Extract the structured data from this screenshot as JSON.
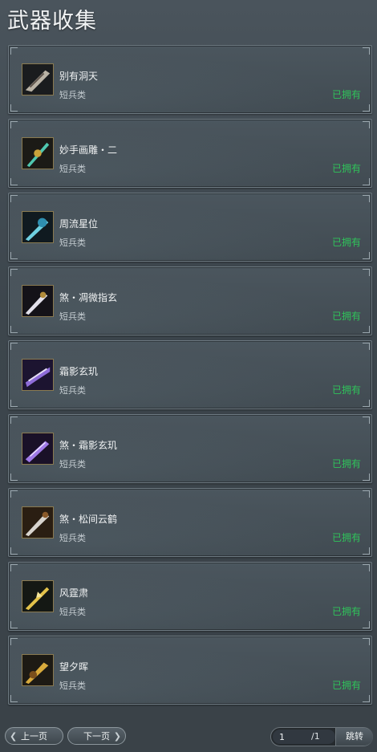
{
  "title": "武器收集",
  "items": [
    {
      "name": "别有洞天",
      "category": "短兵类",
      "status": "已拥有",
      "icon": "weapon-icon-1"
    },
    {
      "name": "妙手画雕・二",
      "category": "短兵类",
      "status": "已拥有",
      "icon": "weapon-icon-2"
    },
    {
      "name": "周流星位",
      "category": "短兵类",
      "status": "已拥有",
      "icon": "weapon-icon-3"
    },
    {
      "name": "煞・凋微指玄",
      "category": "短兵类",
      "status": "已拥有",
      "icon": "weapon-icon-4"
    },
    {
      "name": "霜影玄玑",
      "category": "短兵类",
      "status": "已拥有",
      "icon": "weapon-icon-5"
    },
    {
      "name": "煞・霜影玄玑",
      "category": "短兵类",
      "status": "已拥有",
      "icon": "weapon-icon-6"
    },
    {
      "name": "煞・松间云鹤",
      "category": "短兵类",
      "status": "已拥有",
      "icon": "weapon-icon-7"
    },
    {
      "name": "风霆肃",
      "category": "短兵类",
      "status": "已拥有",
      "icon": "weapon-icon-8"
    },
    {
      "name": "望夕晖",
      "category": "短兵类",
      "status": "已拥有",
      "icon": "weapon-icon-9"
    }
  ],
  "pager": {
    "prev_label": "上一页",
    "next_label": "下一页",
    "current_page": "1",
    "total_pages": "/1",
    "jump_label": "跳转"
  },
  "colors": {
    "owned": "#2fc35a",
    "background": "#40494f",
    "card_border": "#6e7a82"
  }
}
